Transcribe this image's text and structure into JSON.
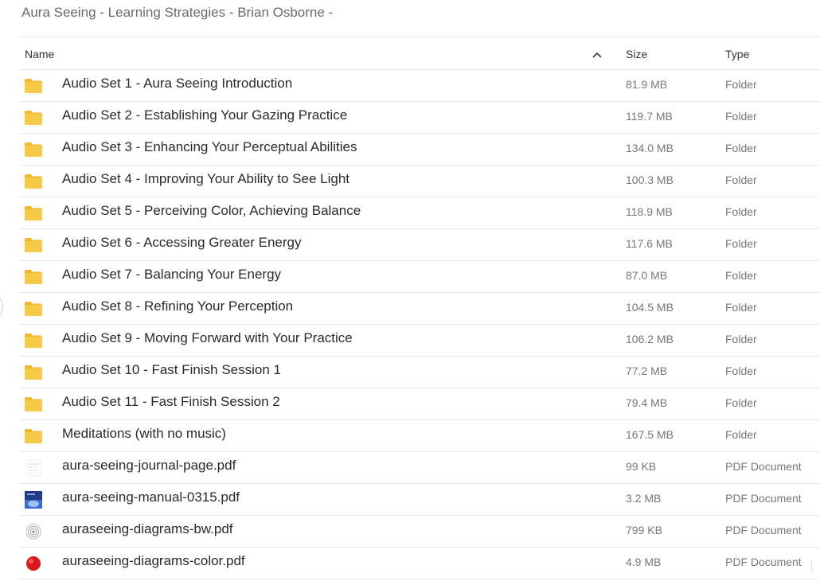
{
  "breadcrumb": "Aura Seeing - Learning Strategies - Brian Osborne -",
  "columns": {
    "name": "Name",
    "size": "Size",
    "type": "Type"
  },
  "sort": {
    "column": "name",
    "direction": "ascending"
  },
  "rows": [
    {
      "name": "Audio Set 1 - Aura Seeing Introduction",
      "size": "81.9 MB",
      "type": "Folder",
      "icon": "folder-icon"
    },
    {
      "name": "Audio Set 2 - Establishing Your Gazing Practice",
      "size": "119.7 MB",
      "type": "Folder",
      "icon": "folder-icon"
    },
    {
      "name": "Audio Set 3 - Enhancing Your Perceptual Abilities",
      "size": "134.0 MB",
      "type": "Folder",
      "icon": "folder-icon"
    },
    {
      "name": "Audio Set 4 - Improving Your Ability to See Light",
      "size": "100.3 MB",
      "type": "Folder",
      "icon": "folder-icon"
    },
    {
      "name": "Audio Set 5 - Perceiving Color, Achieving Balance",
      "size": "118.9 MB",
      "type": "Folder",
      "icon": "folder-icon"
    },
    {
      "name": "Audio Set 6 - Accessing Greater Energy",
      "size": "117.6 MB",
      "type": "Folder",
      "icon": "folder-icon"
    },
    {
      "name": "Audio Set 7 - Balancing Your Energy",
      "size": "87.0 MB",
      "type": "Folder",
      "icon": "folder-icon"
    },
    {
      "name": "Audio Set 8 - Refining Your Perception",
      "size": "104.5 MB",
      "type": "Folder",
      "icon": "folder-icon"
    },
    {
      "name": "Audio Set 9 - Moving Forward with Your Practice",
      "size": "106.2 MB",
      "type": "Folder",
      "icon": "folder-icon"
    },
    {
      "name": "Audio Set 10 - Fast Finish Session 1",
      "size": "77.2 MB",
      "type": "Folder",
      "icon": "folder-icon"
    },
    {
      "name": "Audio Set 11 - Fast Finish Session 2",
      "size": "79.4 MB",
      "type": "Folder",
      "icon": "folder-icon"
    },
    {
      "name": "Meditations (with no music)",
      "size": "167.5 MB",
      "type": "Folder",
      "icon": "folder-icon"
    },
    {
      "name": "aura-seeing-journal-page.pdf",
      "size": "99 KB",
      "type": "PDF Document",
      "icon": "pdf-journal-thumbnail-icon"
    },
    {
      "name": "aura-seeing-manual-0315.pdf",
      "size": "3.2 MB",
      "type": "PDF Document",
      "icon": "pdf-manual-thumbnail-icon"
    },
    {
      "name": "auraseeing-diagrams-bw.pdf",
      "size": "799 KB",
      "type": "PDF Document",
      "icon": "pdf-diagram-bw-thumbnail-icon"
    },
    {
      "name": "auraseeing-diagrams-color.pdf",
      "size": "4.9 MB",
      "type": "PDF Document",
      "icon": "pdf-diagram-color-thumbnail-icon"
    }
  ],
  "colors": {
    "folder": "#f7c948",
    "folder_tab": "#f1b92d",
    "text": "#2a2a2a",
    "muted": "#777777",
    "divider": "#e8e8e8"
  }
}
